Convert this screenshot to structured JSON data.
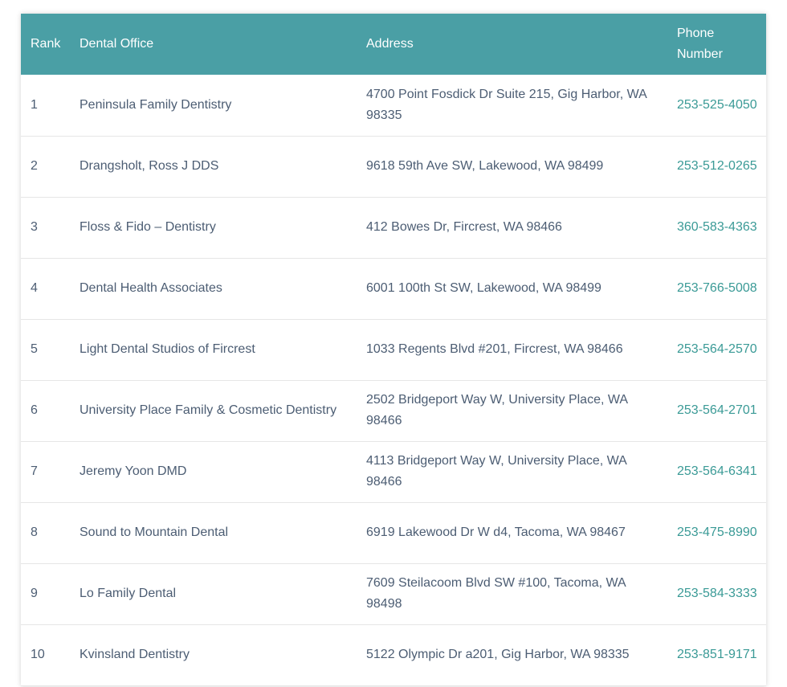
{
  "table": {
    "headers": {
      "rank": "Rank",
      "office": "Dental Office",
      "address": "Address",
      "phone": "Phone Number"
    },
    "rows": [
      {
        "rank": "1",
        "office": "Peninsula Family Dentistry",
        "address": "4700 Point Fosdick Dr Suite 215, Gig Harbor, WA 98335",
        "phone": "253-525-4050"
      },
      {
        "rank": "2",
        "office": "Drangsholt, Ross J DDS",
        "address": "9618 59th Ave SW, Lakewood, WA 98499",
        "phone": "253-512-0265"
      },
      {
        "rank": "3",
        "office": "Floss & Fido – Dentistry",
        "address": "412 Bowes Dr, Fircrest, WA 98466",
        "phone": "360-583-4363"
      },
      {
        "rank": "4",
        "office": "Dental Health Associates",
        "address": "6001 100th St SW, Lakewood, WA 98499",
        "phone": "253-766-5008"
      },
      {
        "rank": "5",
        "office": "Light Dental Studios of Fircrest",
        "address": "1033 Regents Blvd #201, Fircrest, WA 98466",
        "phone": "253-564-2570"
      },
      {
        "rank": "6",
        "office": "University Place Family & Cosmetic Dentistry",
        "address": "2502 Bridgeport Way W, University Place, WA 98466",
        "phone": "253-564-2701"
      },
      {
        "rank": "7",
        "office": "Jeremy Yoon DMD",
        "address": "4113 Bridgeport Way W, University Place, WA 98466",
        "phone": "253-564-6341"
      },
      {
        "rank": "8",
        "office": "Sound to Mountain Dental",
        "address": "6919 Lakewood Dr W d4, Tacoma, WA 98467",
        "phone": "253-475-8990"
      },
      {
        "rank": "9",
        "office": "Lo Family Dental",
        "address": "7609 Steilacoom Blvd SW #100, Tacoma, WA 98498",
        "phone": "253-584-3333"
      },
      {
        "rank": "10",
        "office": "Kvinsland Dentistry",
        "address": "5122 Olympic Dr a201, Gig Harbor, WA 98335",
        "phone": "253-851-9171"
      }
    ]
  },
  "colors": {
    "header_bg": "#4a9fa5",
    "header_text": "#ffffff",
    "body_text": "#4c5d73",
    "phone_link": "#3a9a96",
    "row_divider": "#e6e6e6"
  }
}
